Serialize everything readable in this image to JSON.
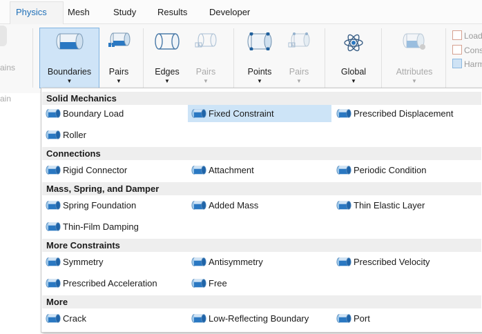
{
  "tabs": [
    "Physics",
    "Mesh",
    "Study",
    "Results",
    "Developer"
  ],
  "ribbon": {
    "left_partial": [
      "ains",
      "ain"
    ],
    "buttons": [
      {
        "label": "Boundaries",
        "has_menu": true,
        "enabled": true,
        "selected": true,
        "icon": "boundary-cylinder-icon"
      },
      {
        "label": "Pairs",
        "has_menu": true,
        "enabled": true,
        "icon": "boundary-pair-icon"
      },
      {
        "label": "Edges",
        "has_menu": true,
        "enabled": true,
        "icon": "edge-cylinder-icon"
      },
      {
        "label": "Pairs",
        "has_menu": true,
        "enabled": false,
        "icon": "edge-pair-icon"
      },
      {
        "label": "Points",
        "has_menu": true,
        "enabled": true,
        "icon": "point-cylinder-icon"
      },
      {
        "label": "Pairs",
        "has_menu": true,
        "enabled": false,
        "icon": "point-pair-icon"
      },
      {
        "label": "Global",
        "has_menu": true,
        "enabled": true,
        "icon": "atom-icon"
      },
      {
        "label": "Attributes",
        "has_menu": true,
        "enabled": false,
        "icon": "attributes-icon"
      }
    ],
    "small_buttons": [
      "Load",
      "Cons",
      "Harm"
    ]
  },
  "menu": {
    "sections": [
      {
        "title": "Solid Mechanics",
        "items": [
          "Boundary Load",
          "Fixed Constraint",
          "Prescribed Displacement",
          "Roller"
        ]
      },
      {
        "title": "Connections",
        "items": [
          "Rigid Connector",
          "Attachment",
          "Periodic Condition"
        ]
      },
      {
        "title": "Mass, Spring, and Damper",
        "items": [
          "Spring Foundation",
          "Added Mass",
          "Thin Elastic Layer",
          "Thin-Film Damping"
        ]
      },
      {
        "title": "More Constraints",
        "items": [
          "Symmetry",
          "Antisymmetry",
          "Prescribed Velocity",
          "Prescribed Acceleration",
          "Free"
        ]
      },
      {
        "title": "More",
        "items": [
          "Crack",
          "Low-Reflecting Boundary",
          "Port"
        ]
      }
    ],
    "highlighted_item": "Fixed Constraint"
  },
  "colors": {
    "accent": "#1e6fb8",
    "boundary_icon_fill": "#2a78c2",
    "highlight": "#cde4f7"
  }
}
